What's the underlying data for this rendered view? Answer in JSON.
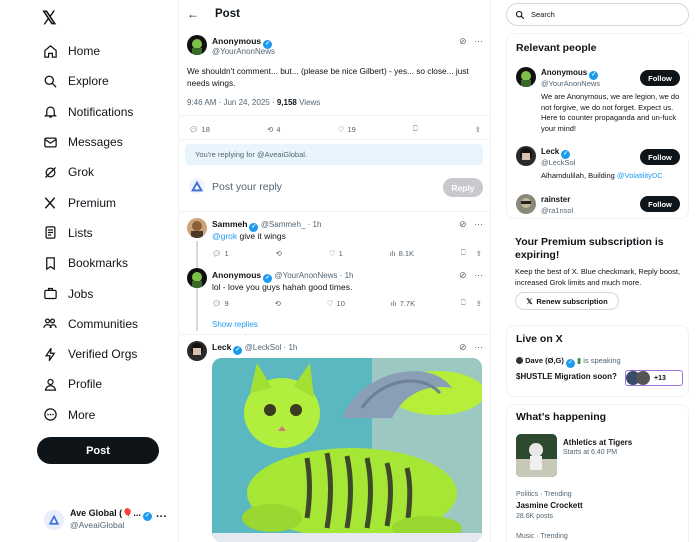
{
  "nav": {
    "logo": "𝕏",
    "items": [
      {
        "label": "Home",
        "icon": "home-icon"
      },
      {
        "label": "Explore",
        "icon": "search-icon"
      },
      {
        "label": "Notifications",
        "icon": "bell-icon"
      },
      {
        "label": "Messages",
        "icon": "mail-icon"
      },
      {
        "label": "Grok",
        "icon": "grok-icon"
      },
      {
        "label": "Premium",
        "icon": "x-icon"
      },
      {
        "label": "Lists",
        "icon": "list-icon"
      },
      {
        "label": "Bookmarks",
        "icon": "bookmark-icon"
      },
      {
        "label": "Jobs",
        "icon": "briefcase-icon"
      },
      {
        "label": "Communities",
        "icon": "people-icon"
      },
      {
        "label": "Verified Orgs",
        "icon": "lightning-icon"
      },
      {
        "label": "Profile",
        "icon": "person-icon"
      },
      {
        "label": "More",
        "icon": "more-circle-icon"
      }
    ],
    "post_label": "Post",
    "account": {
      "name": "Ave Global (🎈...",
      "handle": "@AveaiGlobal",
      "more": "···"
    }
  },
  "header": {
    "title": "Post",
    "back": "←"
  },
  "main_post": {
    "name": "Anonymous",
    "handle": "@YourAnonNews",
    "text": "We shouldn't comment... but... (please be nice Gilbert) - yes... so close... just needs wings.",
    "time": "9:46 AM · Jun 24, 2025 · ",
    "views": "9,158",
    "views_label": " Views",
    "replies": "18",
    "reposts": "4",
    "likes": "19"
  },
  "reply_box": {
    "replying_to": "You're replying for @AveaiGlobal.",
    "placeholder": "Post your reply",
    "button": "Reply"
  },
  "replies": [
    {
      "name": "Sammeh",
      "handle": "@Sammeh_ · 1h",
      "mention": "@grok",
      "text": " give it wings",
      "replies": "1",
      "reposts": "",
      "likes": "1",
      "views": "8.1K"
    },
    {
      "name": "Anonymous",
      "handle": "@YourAnonNews · 1h",
      "text": "lol - love you guys hahah good times.",
      "replies": "9",
      "reposts": "",
      "likes": "10",
      "views": "7.7K"
    },
    {
      "name": "Leck",
      "handle": "@LeckSol · 1h"
    }
  ],
  "show_replies": "Show replies",
  "right": {
    "search_placeholder": "Search",
    "relevant_title": "Relevant people",
    "people": [
      {
        "name": "Anonymous",
        "handle": "@YourAnonNews",
        "bio": "We are Anonymous, we are legion, we do not forgive, we do not forget. Expect us. Here to counter propaganda and un-fuck your mind!",
        "follow": "Follow"
      },
      {
        "name": "Leck",
        "handle": "@LeckSol",
        "bio": "Alhamdulilah, Building ",
        "bio_link": "@VolatilityDC",
        "follow": "Follow"
      },
      {
        "name": "rainster",
        "handle": "@ra1nsol",
        "follow": "Follow"
      }
    ],
    "premium": {
      "title": "Your Premium subscription is expiring!",
      "body": "Keep the best of X. Blue checkmark, Reply boost, increased Grok limits and much more.",
      "button": "Renew subscription"
    },
    "live": {
      "title": "Live on X",
      "host": "Dave (Ø,G)",
      "status": "is speaking",
      "space": "$HUSTLE Migration soon?",
      "count": "+13"
    },
    "happening": {
      "title": "What’s happening",
      "event": "Athletics at Tigers",
      "event_time": "Starts at 6:40 PM",
      "trends": [
        {
          "meta": "Politics · Trending",
          "name": "Jasmine Crockett",
          "posts": "28.6K posts"
        },
        {
          "meta": "Music · Trending",
          "name": "",
          "posts": ""
        }
      ]
    }
  }
}
